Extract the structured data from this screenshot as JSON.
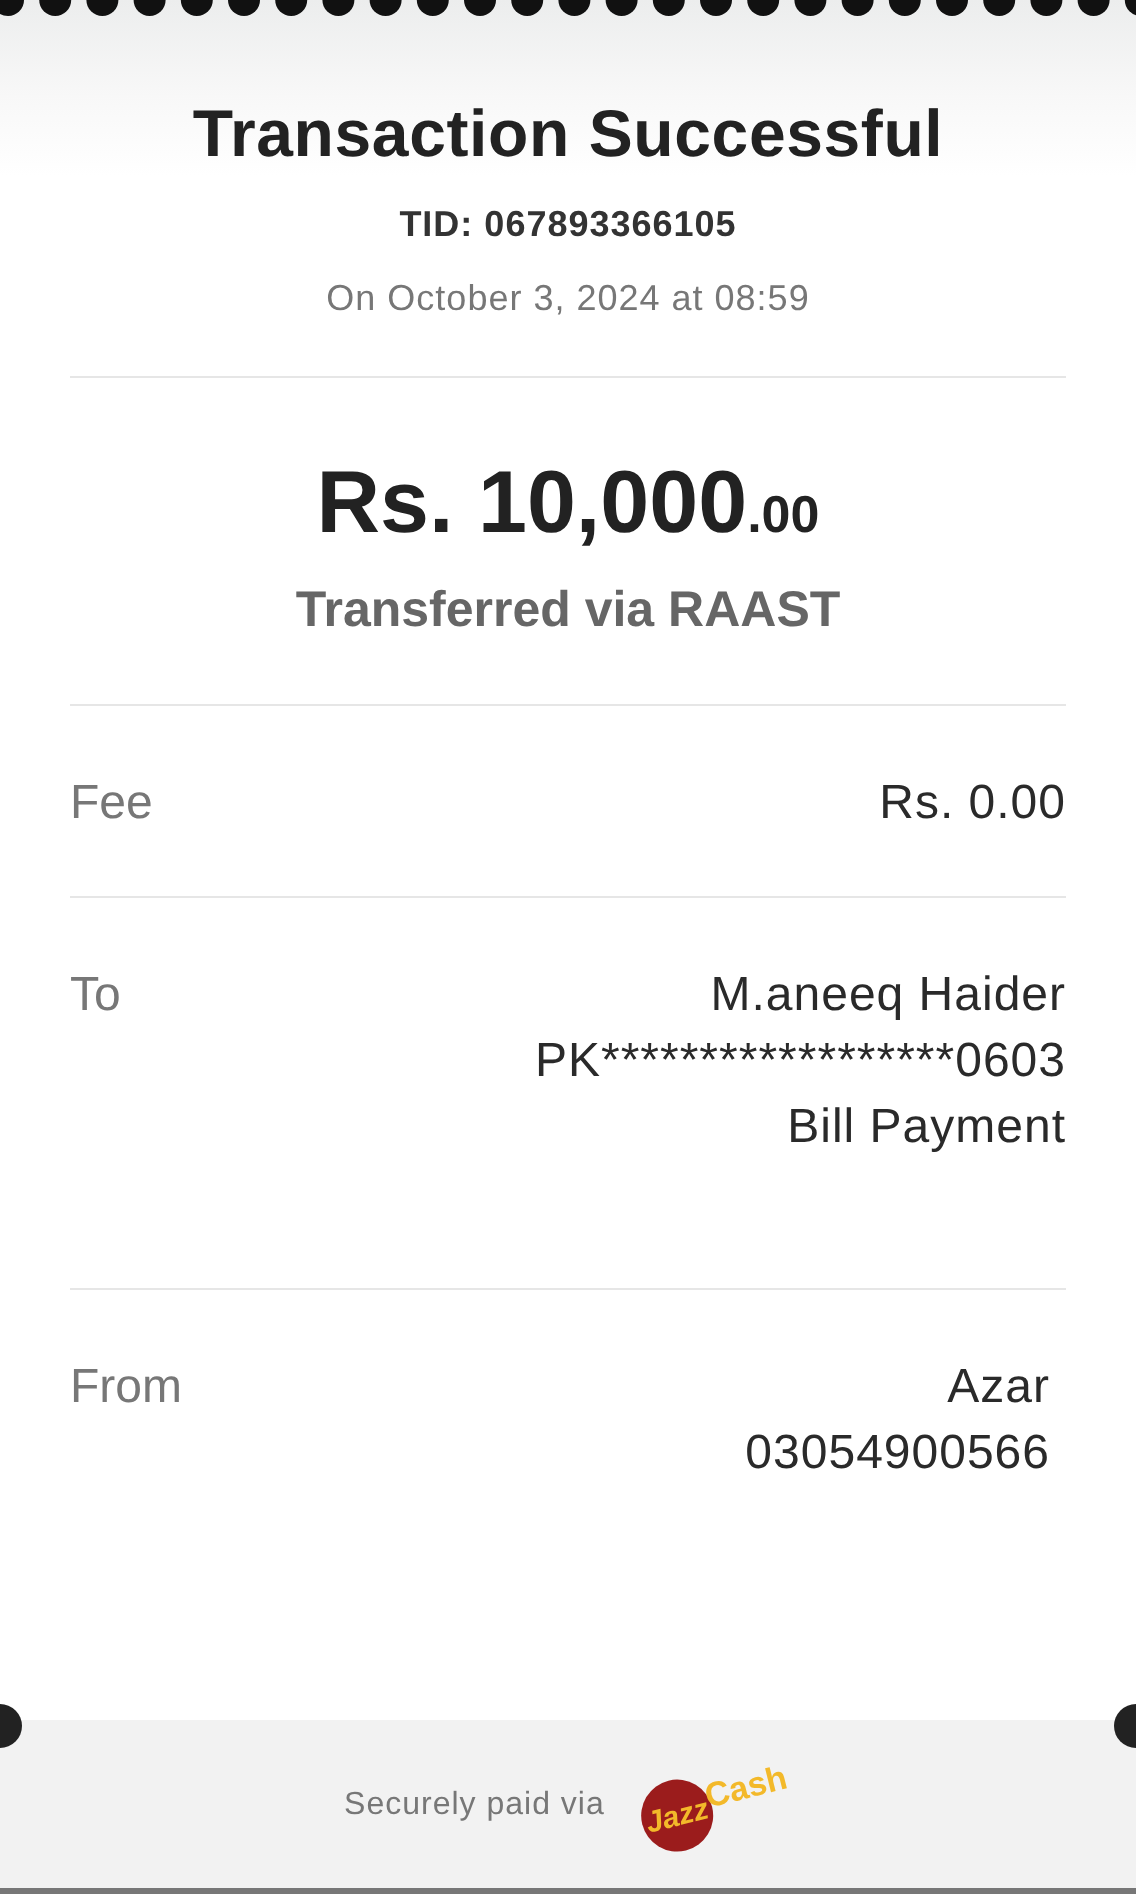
{
  "header": {
    "title": "Transaction Successful",
    "tid": "TID: 067893366105",
    "date": "On October 3, 2024 at 08:59"
  },
  "amount": {
    "main": "Rs. 10,000",
    "decimals": ".00",
    "method": "Transferred via RAAST"
  },
  "details": [
    {
      "label": "Fee",
      "lines": [
        "Rs. 0.00"
      ]
    },
    {
      "label": "To",
      "lines": [
        "M.aneeq Haider",
        "PK******************0603",
        "Bill Payment"
      ]
    },
    {
      "label": "From",
      "lines": [
        "Azar",
        "03054900566"
      ]
    }
  ],
  "footer": {
    "text": "Securely paid via",
    "logo": {
      "primary": "Jazz",
      "secondary": "Cash"
    }
  }
}
